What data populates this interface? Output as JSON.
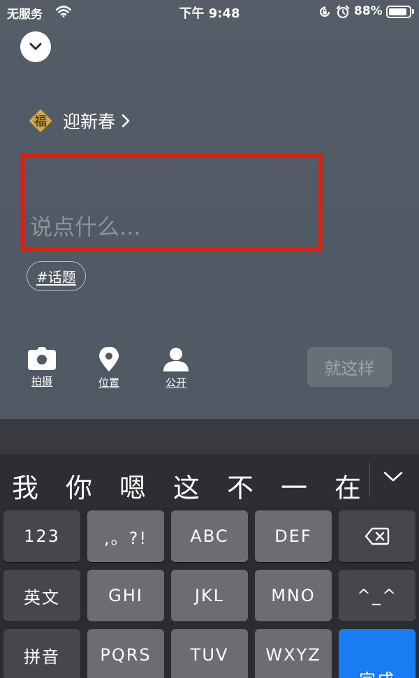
{
  "status_bar": {
    "carrier": "无服务",
    "time": "下午 9:48",
    "battery_percent": "88%",
    "battery_level": 0.88
  },
  "post": {
    "topic_badge": "福",
    "topic_title": "迎新春",
    "placeholder": "说点什么...",
    "hashtag": "#话题"
  },
  "toolbar": {
    "photo_label": "拍摄",
    "location_label": "位置",
    "privacy_label": "公开",
    "submit_label": "就这样"
  },
  "keyboard": {
    "candidates": [
      "我",
      "你",
      "嗯",
      "这",
      "不",
      "一",
      "在"
    ],
    "keys": {
      "num": "123",
      "punct": ",。?!",
      "abc": "ABC",
      "def": "DEF",
      "lang": "英文",
      "ghi": "GHI",
      "jkl": "JKL",
      "mno": "MNO",
      "emoticon": "^_^",
      "pinyin": "拼音",
      "pqrs": "PQRS",
      "tuv": "TUV",
      "wxyz": "WXYZ",
      "done": "完成"
    }
  },
  "colors": {
    "highlight_border": "#d3240f",
    "done_key": "#1a7cf2",
    "badge_gold": "#c49a3a"
  }
}
